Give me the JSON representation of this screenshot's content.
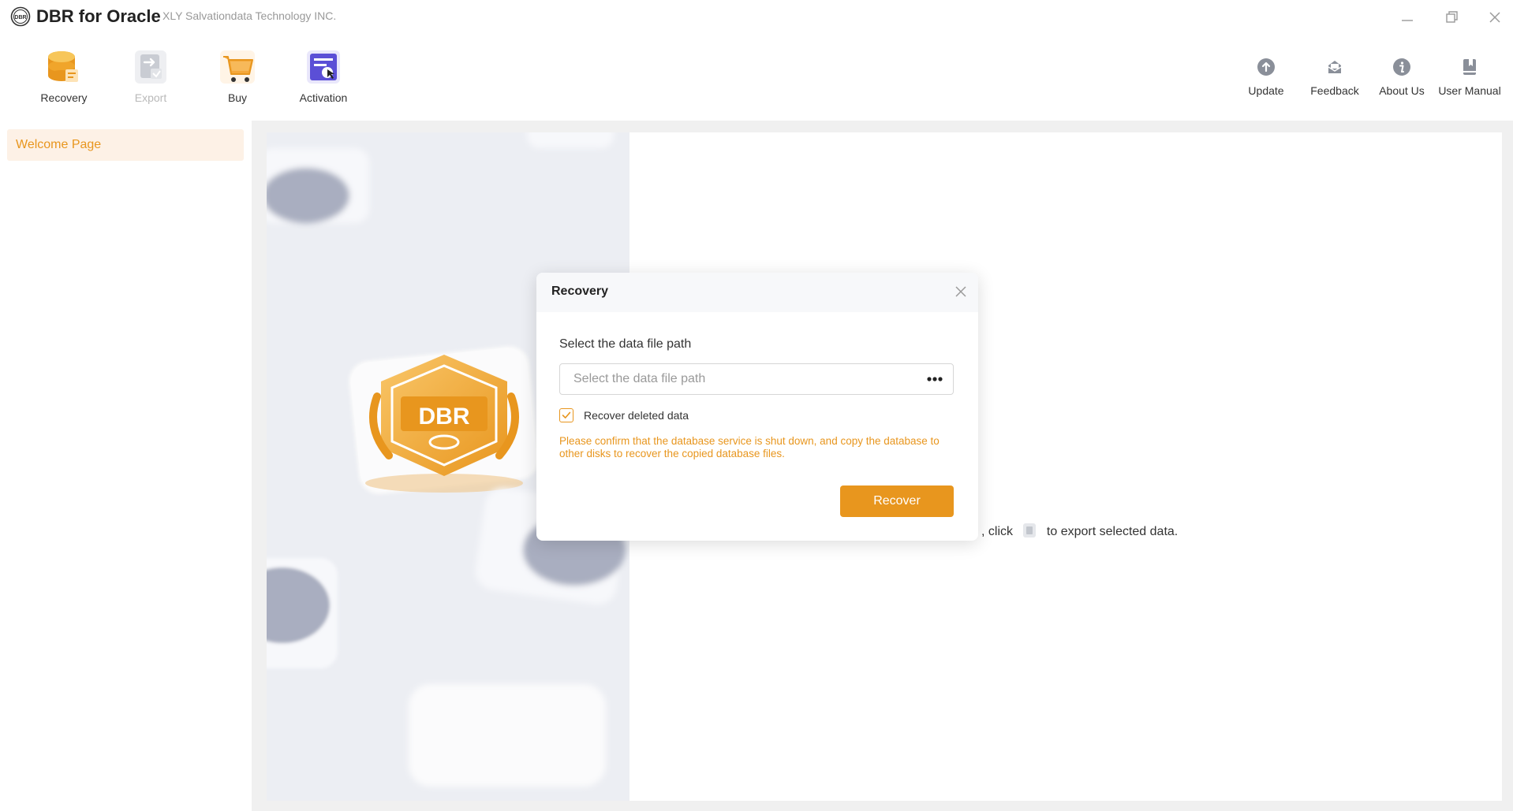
{
  "app": {
    "title": "DBR for Oracle",
    "company": "XLY Salvationdata Technology INC.",
    "logo_text": "DBR"
  },
  "window_controls": {
    "minimize_icon": "minimize-icon",
    "restore_icon": "restore-icon",
    "close_icon": "close-icon"
  },
  "toolbar": {
    "recovery_label": "Recovery",
    "export_label": "Export",
    "buy_label": "Buy",
    "activation_label": "Activation"
  },
  "right_toolbar": {
    "update_label": "Update",
    "feedback_label": "Feedback",
    "about_label": "About Us",
    "manual_label": "User Manual"
  },
  "sidebar": {
    "items": [
      {
        "label": "Welcome Page",
        "active": true
      }
    ]
  },
  "main": {
    "illustration_badge_text": "DBR",
    "hint_click": ", click",
    "hint_tail": "to export selected data."
  },
  "dialog": {
    "title": "Recovery",
    "path_label": "Select the data file path",
    "path_placeholder": "Select the data file path",
    "path_value": "",
    "checkbox_label": "Recover deleted data",
    "checkbox_checked": true,
    "warning": "Please confirm that the database service is shut down, and copy the database to other disks to recover the copied database files.",
    "recover_button": "Recover"
  },
  "colors": {
    "accent": "#e8961e",
    "active_bg": "#fdf1e6",
    "activation_icon": "#5b4fd6",
    "disabled_text": "#b9b9b9",
    "icon_gray": "#8a8f99"
  }
}
